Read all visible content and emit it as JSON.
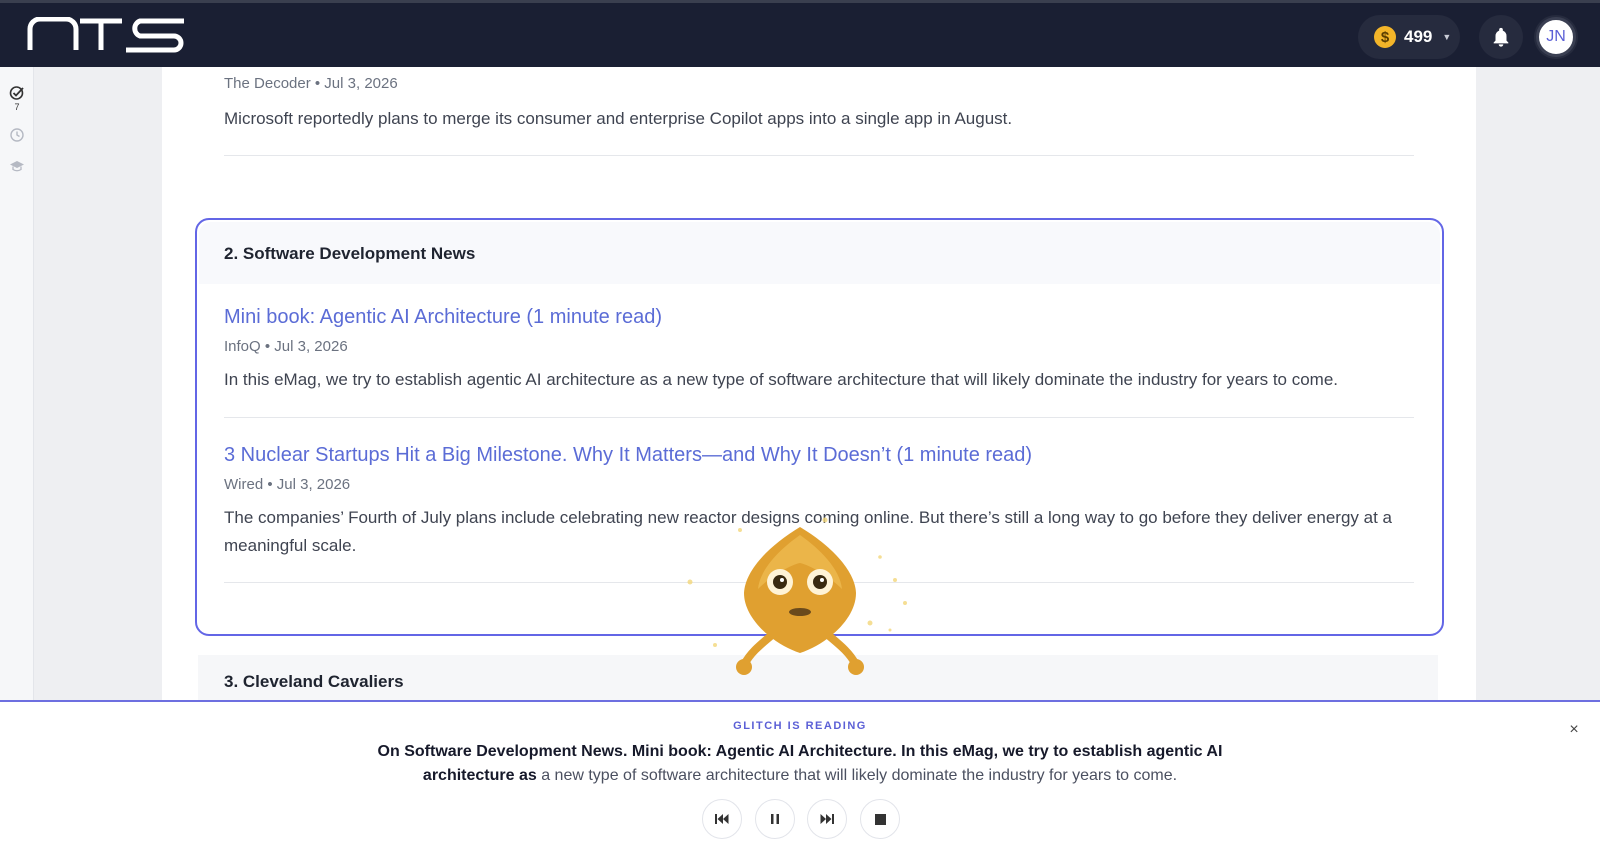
{
  "topbar": {
    "logo_text": "NTS",
    "coins": "499",
    "avatar_initials": "JN",
    "icons": [
      "coin-icon",
      "chevron-down-icon",
      "bell-icon"
    ]
  },
  "rail": {
    "tasks_count": "7",
    "icons": [
      "check-badge-icon",
      "clock-icon",
      "graduation-cap-icon"
    ]
  },
  "prev_article": {
    "meta": "The Decoder • Jul 3, 2026",
    "summary": "Microsoft reportedly plans to merge its consumer and enterprise Copilot apps into a single app in August."
  },
  "section": {
    "title": "2. Software Development News",
    "articles": [
      {
        "headline": "Mini book: Agentic AI Architecture (1 minute read)",
        "meta": "InfoQ • Jul 3, 2026",
        "summary": "In this eMag, we try to establish agentic AI architecture as a new type of software architecture that will likely dominate the industry for years to come."
      },
      {
        "headline": "3 Nuclear Startups Hit a Big Milestone. Why It Matters—and Why It Doesn’t (1 minute read)",
        "meta": "Wired • Jul 3, 2026",
        "summary": "The companies’ Fourth of July plans include celebrating new reactor designs coming online. But there’s still a long way to go before they deliver energy at a meaningful scale."
      }
    ]
  },
  "next_section": {
    "title": "3. Cleveland Cavaliers"
  },
  "reader": {
    "label": "GLITCH IS READING",
    "read_text": "On Software Development News. Mini book: Agentic AI Architecture. In this eMag, we try to establish agentic AI architecture as",
    "unread_text": " a new type of software architecture that will likely dominate the industry for years to come.",
    "controls": [
      "skip-back-icon",
      "pause-icon",
      "skip-forward-icon",
      "stop-icon"
    ],
    "close_glyph": "×"
  },
  "colors": {
    "topbar": "#1a1f33",
    "accent": "#6366e6",
    "link": "#5b6cd6",
    "coin": "#f3b529",
    "mascot": "#e0a030"
  }
}
